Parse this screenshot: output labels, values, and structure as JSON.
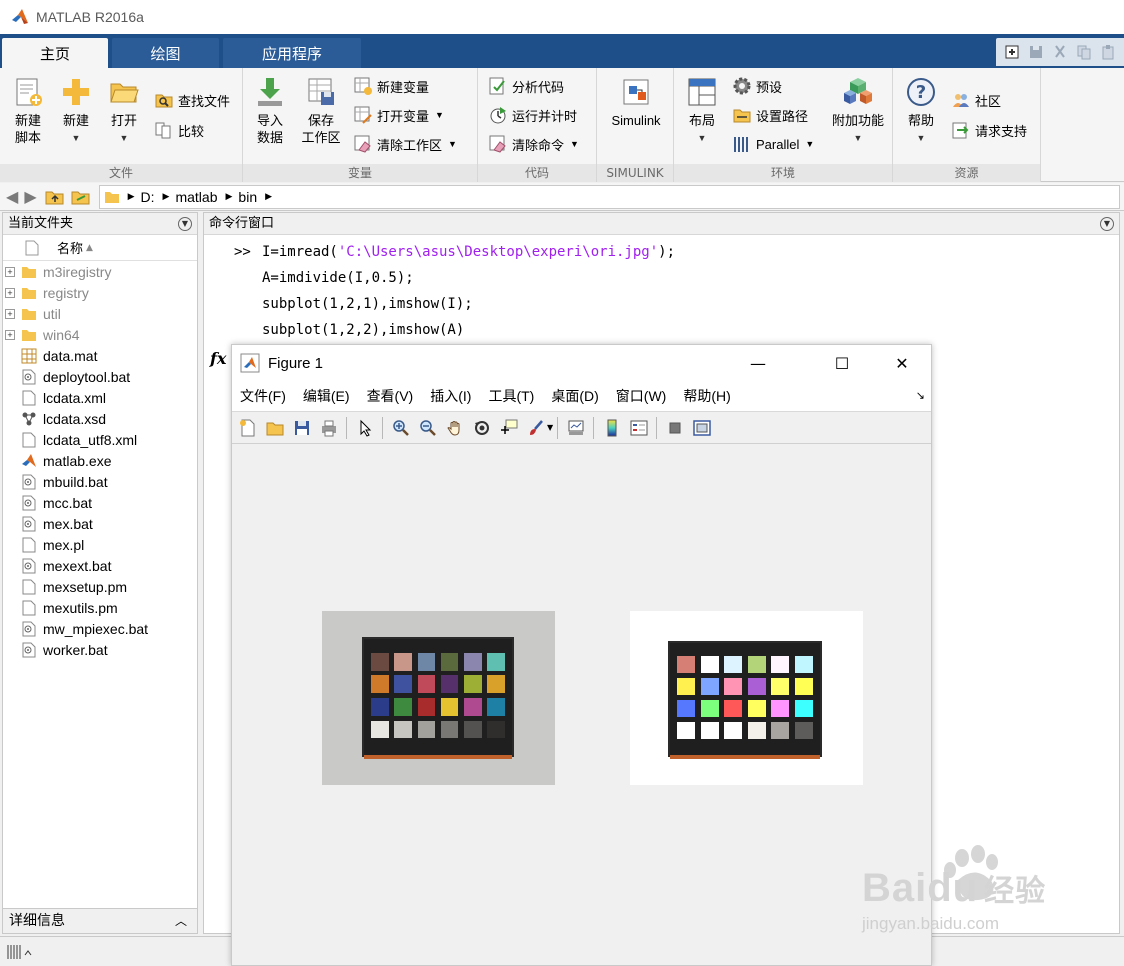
{
  "window": {
    "title": "MATLAB R2016a"
  },
  "ribbon_tabs": [
    "主页",
    "绘图",
    "应用程序"
  ],
  "ribbon": {
    "file_group": {
      "label": "文件",
      "new_script": "新建\n脚本",
      "new": "新建",
      "open": "打开",
      "find_files": "查找文件",
      "compare": "比较"
    },
    "variable_group": {
      "label": "变量",
      "import_data": "导入\n数据",
      "save_workspace": "保存\n工作区",
      "new_variable": "新建变量",
      "open_variable": "打开变量",
      "clear_workspace": "清除工作区"
    },
    "code_group": {
      "label": "代码",
      "analyze_code": "分析代码",
      "run_and_time": "运行并计时",
      "clear_commands": "清除命令"
    },
    "simulink_group": {
      "label": "SIMULINK",
      "simulink": "Simulink"
    },
    "environment_group": {
      "label": "环境",
      "layout": "布局",
      "preferences": "预设",
      "set_path": "设置路径",
      "parallel": "Parallel",
      "add_ons": "附加功能"
    },
    "resources_group": {
      "label": "资源",
      "help": "帮助",
      "community": "社区",
      "request_support": "请求支持"
    }
  },
  "address": {
    "path": [
      "D:",
      "matlab",
      "bin"
    ]
  },
  "current_folder": {
    "title": "当前文件夹",
    "column": "名称",
    "sort_indicator": "▲",
    "items": [
      {
        "name": "m3iregistry",
        "type": "folder"
      },
      {
        "name": "registry",
        "type": "folder"
      },
      {
        "name": "util",
        "type": "folder"
      },
      {
        "name": "win64",
        "type": "folder"
      },
      {
        "name": "data.mat",
        "type": "mat"
      },
      {
        "name": "deploytool.bat",
        "type": "bat"
      },
      {
        "name": "lcdata.xml",
        "type": "doc"
      },
      {
        "name": "lcdata.xsd",
        "type": "xsd"
      },
      {
        "name": "lcdata_utf8.xml",
        "type": "doc"
      },
      {
        "name": "matlab.exe",
        "type": "exe"
      },
      {
        "name": "mbuild.bat",
        "type": "bat"
      },
      {
        "name": "mcc.bat",
        "type": "bat"
      },
      {
        "name": "mex.bat",
        "type": "bat"
      },
      {
        "name": "mex.pl",
        "type": "doc"
      },
      {
        "name": "mexext.bat",
        "type": "bat"
      },
      {
        "name": "mexsetup.pm",
        "type": "doc"
      },
      {
        "name": "mexutils.pm",
        "type": "doc"
      },
      {
        "name": "mw_mpiexec.bat",
        "type": "bat"
      },
      {
        "name": "worker.bat",
        "type": "bat"
      }
    ],
    "details_label": "详细信息"
  },
  "command_window": {
    "title": "命令行窗口",
    "prompt": ">>",
    "lines": [
      {
        "pre": "I=imread(",
        "str": "'C:\\Users\\asus\\Desktop\\experi\\ori.jpg'",
        "post": ");"
      },
      {
        "pre": "A=imdivide(I,0.5);",
        "str": "",
        "post": ""
      },
      {
        "pre": "subplot(1,2,1),imshow(I);",
        "str": "",
        "post": ""
      },
      {
        "pre": "subplot(1,2,2),imshow(A)",
        "str": "",
        "post": ""
      }
    ],
    "fx": "fx"
  },
  "figure": {
    "title": "Figure 1",
    "menu": [
      "文件(F)",
      "编辑(E)",
      "查看(V)",
      "插入(I)",
      "工具(T)",
      "桌面(D)",
      "窗口(W)",
      "帮助(H)"
    ],
    "toolbar_icons": [
      "new-figure-icon",
      "open-file-icon",
      "save-icon",
      "print-icon",
      "pointer-icon",
      "zoom-in-icon",
      "zoom-out-icon",
      "pan-icon",
      "rotate-3d-icon",
      "data-cursor-icon",
      "brush-icon",
      "link-plot-icon",
      "colorbar-icon",
      "legend-icon",
      "hide-plot-tools-icon",
      "show-plot-tools-icon"
    ]
  },
  "colors": {
    "ribbon_blue": "#1e4f89",
    "string_purple": "#a020f0",
    "folder_yellow": "#f4c44e"
  },
  "checker_original": [
    [
      "#6b4a42",
      "#c9968a",
      "#6e87a6",
      "#5a6a3c",
      "#8a86ad",
      "#5fbfb0"
    ],
    [
      "#cf7a2a",
      "#3f52a0",
      "#c04a5a",
      "#55306a",
      "#9db035",
      "#d9a02a"
    ],
    [
      "#2b3c8a",
      "#3e8a3e",
      "#a82c2c",
      "#e4c230",
      "#b04a90",
      "#1f80a6"
    ],
    [
      "#e8e6e0",
      "#c7c5c0",
      "#a3a19c",
      "#7a7875",
      "#545250",
      "#2f2e2d"
    ]
  ],
  "checker_brightened": [
    [
      "#d67f74",
      "#ffffff",
      "#ddf3ff",
      "#b4d47a",
      "#fff5ff",
      "#bff6ff"
    ],
    [
      "#fff04f",
      "#7ea5ff",
      "#ff94b4",
      "#aa60d4",
      "#ffff6a",
      "#ffff54"
    ],
    [
      "#5678ff",
      "#7cff7c",
      "#ff5858",
      "#ffff60",
      "#ff94ff",
      "#3effff"
    ],
    [
      "#ffffff",
      "#ffffff",
      "#ffffff",
      "#f4f0ea",
      "#a8a4a0",
      "#5e5c5a"
    ]
  ],
  "watermark": {
    "brand": "Baidu",
    "brand_cn": "经验",
    "url": "jingyan.baidu.com"
  }
}
